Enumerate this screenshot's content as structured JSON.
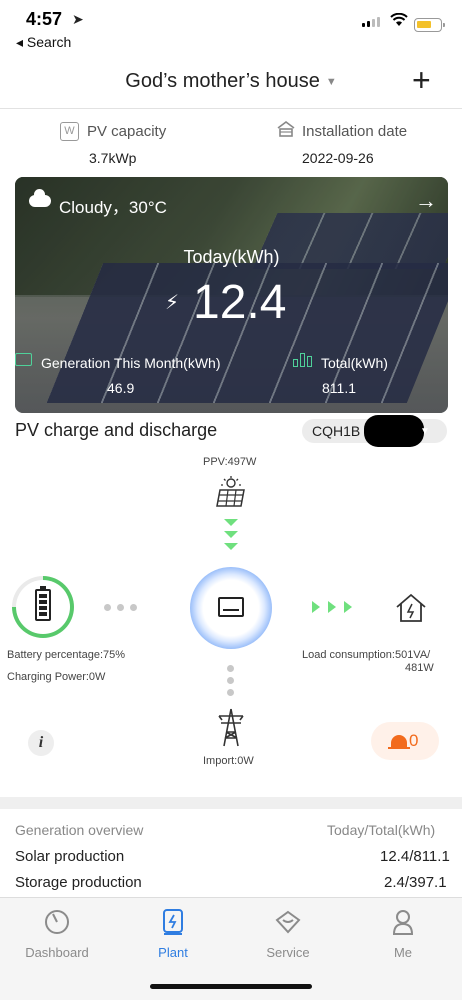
{
  "status": {
    "time": "4:57",
    "back_label": "◂ Search"
  },
  "header": {
    "title": "God’s mother’s house"
  },
  "info": {
    "pv_capacity_label": "PV capacity",
    "pv_capacity_value": "3.7kWp",
    "installation_label": "Installation date",
    "installation_value": "2022-09-26"
  },
  "weather": {
    "condition": "Cloudy，30°C",
    "today_label": "Today(kWh)",
    "today_value": "12.4",
    "month_label": "Generation This Month(kWh)",
    "month_value": "46.9",
    "total_label": "Total(kWh)",
    "total_value": "811.1"
  },
  "flow": {
    "section_title": "PV charge and discharge",
    "device": "CQH1B",
    "ppv": "PPV:497W",
    "battery_percentage": "Battery percentage:75%",
    "battery_level": 0.75,
    "charging_power": "Charging Power:0W",
    "load_line1": "Load consumption:501VA/",
    "load_line2": "481W",
    "import": "Import:0W",
    "alarm_count": "0"
  },
  "overview": {
    "title": "Generation overview",
    "period": "Today/Total(kWh)",
    "rows": [
      {
        "label": "Solar production",
        "value": "12.4/811.1"
      },
      {
        "label": "Storage production",
        "value": "2.4/397.1"
      }
    ]
  },
  "tabs": [
    {
      "label": "Dashboard",
      "active": false
    },
    {
      "label": "Plant",
      "active": true
    },
    {
      "label": "Service",
      "active": false
    },
    {
      "label": "Me",
      "active": false
    }
  ],
  "colors": {
    "accent": "#2f7de1",
    "green": "#58c96b",
    "alarm": "#f26b1d"
  }
}
